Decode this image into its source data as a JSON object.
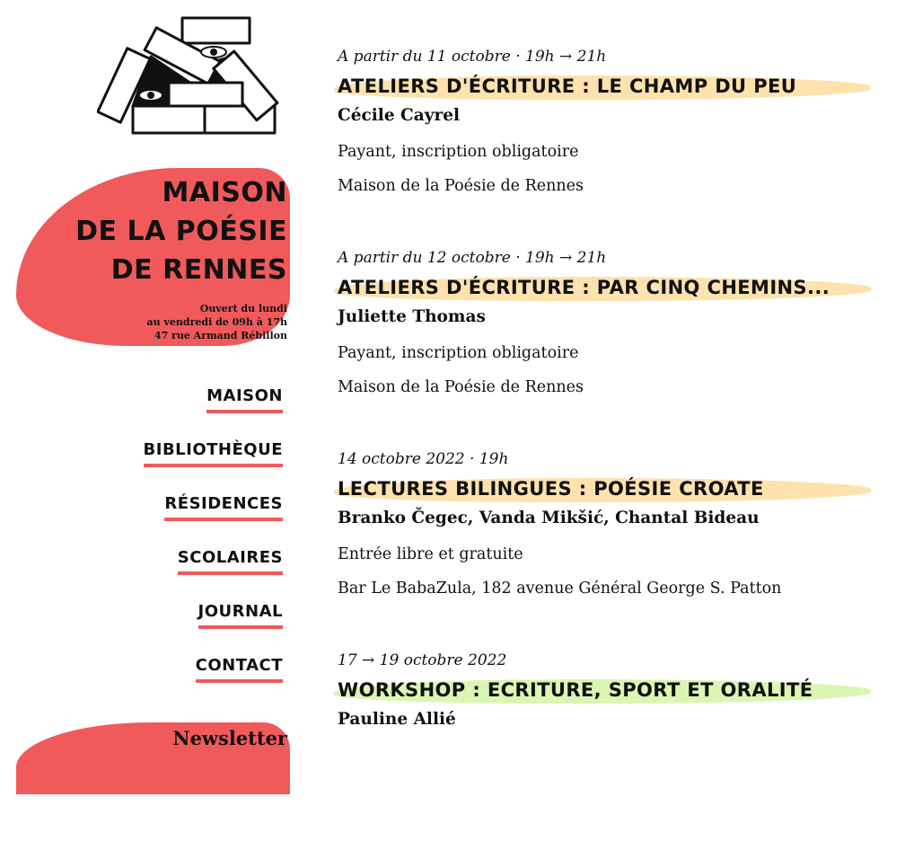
{
  "site": {
    "title_lines": [
      "MAISON",
      "DE LA POÉSIE",
      "DE RENNES"
    ],
    "hours_lines": [
      "Ouvert du lundi",
      "au vendredi de 09h à 17h",
      "47 rue Armand Rébillon"
    ]
  },
  "nav": {
    "items": [
      {
        "label": "MAISON"
      },
      {
        "label": "BIBLIOTHÈQUE"
      },
      {
        "label": "RÉSIDENCES"
      },
      {
        "label": "SCOLAIRES"
      },
      {
        "label": "JOURNAL"
      },
      {
        "label": "CONTACT"
      }
    ],
    "newsletter": "Newsletter"
  },
  "colors": {
    "accent_red": "#f05a5b",
    "highlight_orange": "#fde2ad",
    "highlight_green": "#dbf5b3"
  },
  "events": [
    {
      "date": "A partir du 11 octobre · 19h → 21h",
      "title": "ATELIERS D'ÉCRITURE : LE CHAMP DU PEU",
      "authors": "Cécile Cayrel",
      "price": "Payant, inscription obligatoire",
      "place": "Maison de la Poésie de Rennes",
      "highlight": "#fde2ad"
    },
    {
      "date": "A partir du 12 octobre · 19h → 21h",
      "title": "ATELIERS D'ÉCRITURE : PAR CINQ CHEMINS...",
      "authors": "Juliette Thomas",
      "price": "Payant, inscription obligatoire",
      "place": "Maison de la Poésie de Rennes",
      "highlight": "#fde2ad"
    },
    {
      "date": "14 octobre 2022 · 19h",
      "title": "LECTURES BILINGUES : POÉSIE CROATE",
      "authors": "Branko Čegec, Vanda Mikšić, Chantal Bideau",
      "price": "Entrée libre et gratuite",
      "place": "Bar Le BabaZula, 182 avenue Général George S. Patton",
      "highlight": "#fde2ad"
    },
    {
      "date": "17 → 19 octobre 2022",
      "title": "WORKSHOP : ECRITURE, SPORT ET ORALITÉ",
      "authors": "Pauline Allié",
      "price": "",
      "place": "",
      "highlight": "#dbf5b3"
    }
  ]
}
